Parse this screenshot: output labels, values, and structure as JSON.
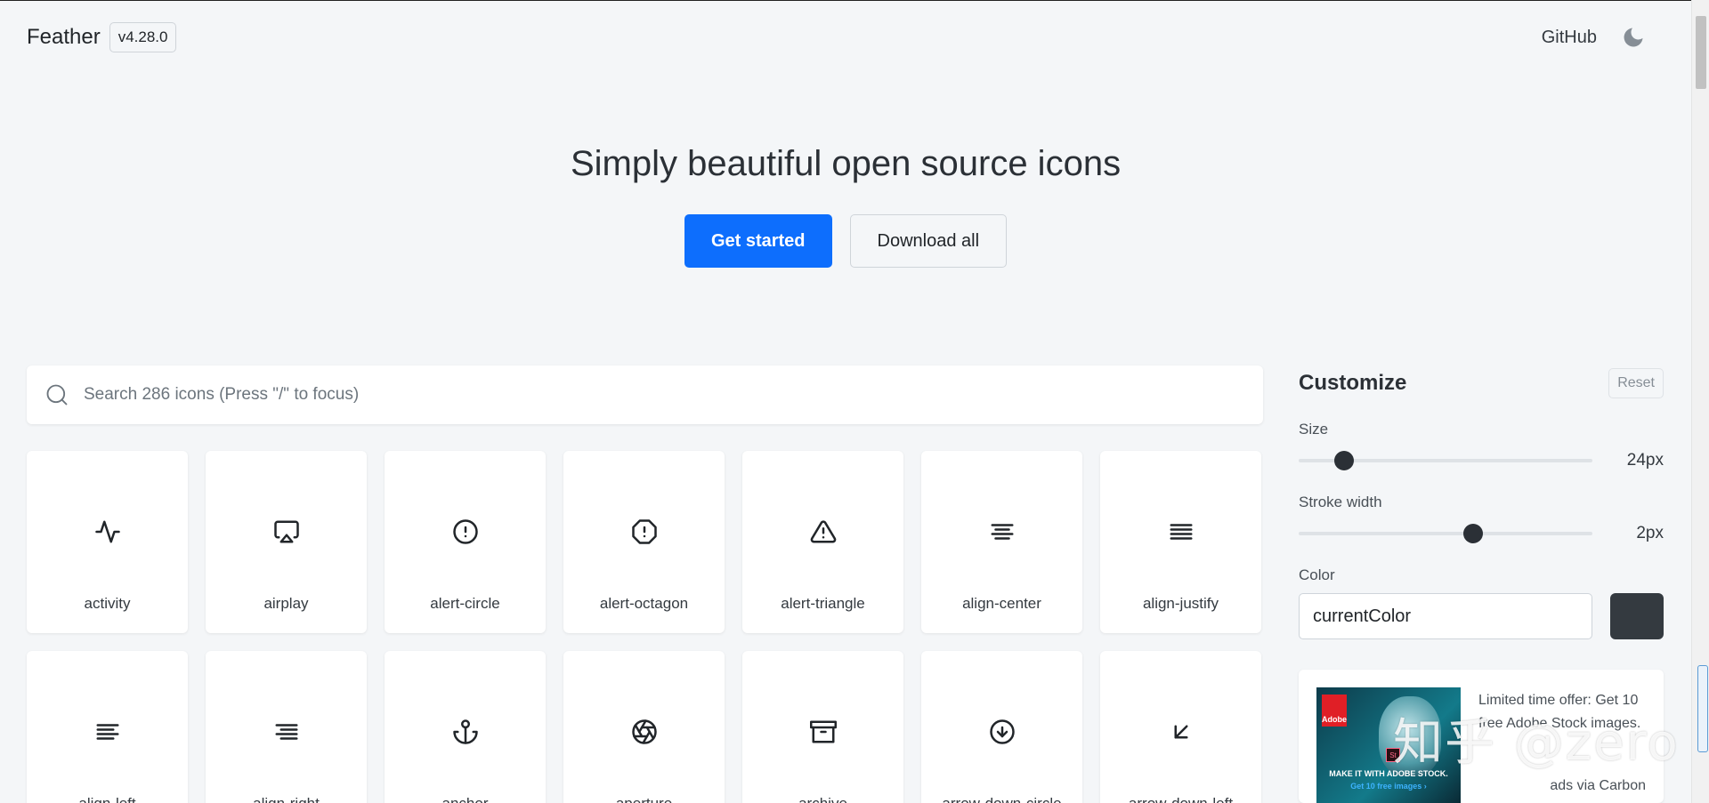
{
  "header": {
    "brand": "Feather",
    "version": "v4.28.0",
    "github": "GitHub",
    "theme_icon": "moon-icon"
  },
  "hero": {
    "title": "Simply beautiful open source icons",
    "primary_button": "Get started",
    "secondary_button": "Download all"
  },
  "search": {
    "placeholder": "Search 286 icons (Press \"/\" to focus)",
    "icon": "search-icon"
  },
  "icons": [
    {
      "label": "activity",
      "icon": "activity"
    },
    {
      "label": "airplay",
      "icon": "airplay"
    },
    {
      "label": "alert-circle",
      "icon": "alert-circle"
    },
    {
      "label": "alert-octagon",
      "icon": "alert-octagon"
    },
    {
      "label": "alert-triangle",
      "icon": "alert-triangle"
    },
    {
      "label": "align-center",
      "icon": "align-center"
    },
    {
      "label": "align-justify",
      "icon": "align-justify"
    },
    {
      "label": "align-left",
      "icon": "align-left"
    },
    {
      "label": "align-right",
      "icon": "align-right"
    },
    {
      "label": "anchor",
      "icon": "anchor"
    },
    {
      "label": "aperture",
      "icon": "aperture"
    },
    {
      "label": "archive",
      "icon": "archive"
    },
    {
      "label": "arrow-down-circle",
      "icon": "arrow-down-circle"
    },
    {
      "label": "arrow-down-left",
      "icon": "arrow-down-left"
    }
  ],
  "customize": {
    "title": "Customize",
    "reset": "Reset",
    "size_label": "Size",
    "size_value": "24px",
    "size_fraction": 0.155,
    "stroke_label": "Stroke width",
    "stroke_value": "2px",
    "stroke_fraction": 0.595,
    "color_label": "Color",
    "color_value": "currentColor",
    "swatch_color": "#343a40"
  },
  "ad": {
    "brand": "Adobe",
    "badge": "St",
    "caption_line1": "MAKE IT WITH ADOBE STOCK.",
    "caption_line2": "Get 10 free images ›",
    "text": "Limited time offer: Get 10 free Adobe Stock images.",
    "via": "ads via Carbon"
  },
  "watermark": "知乎 @zero",
  "colors": {
    "accent": "#0d6efd",
    "background": "#f4f6f8"
  }
}
